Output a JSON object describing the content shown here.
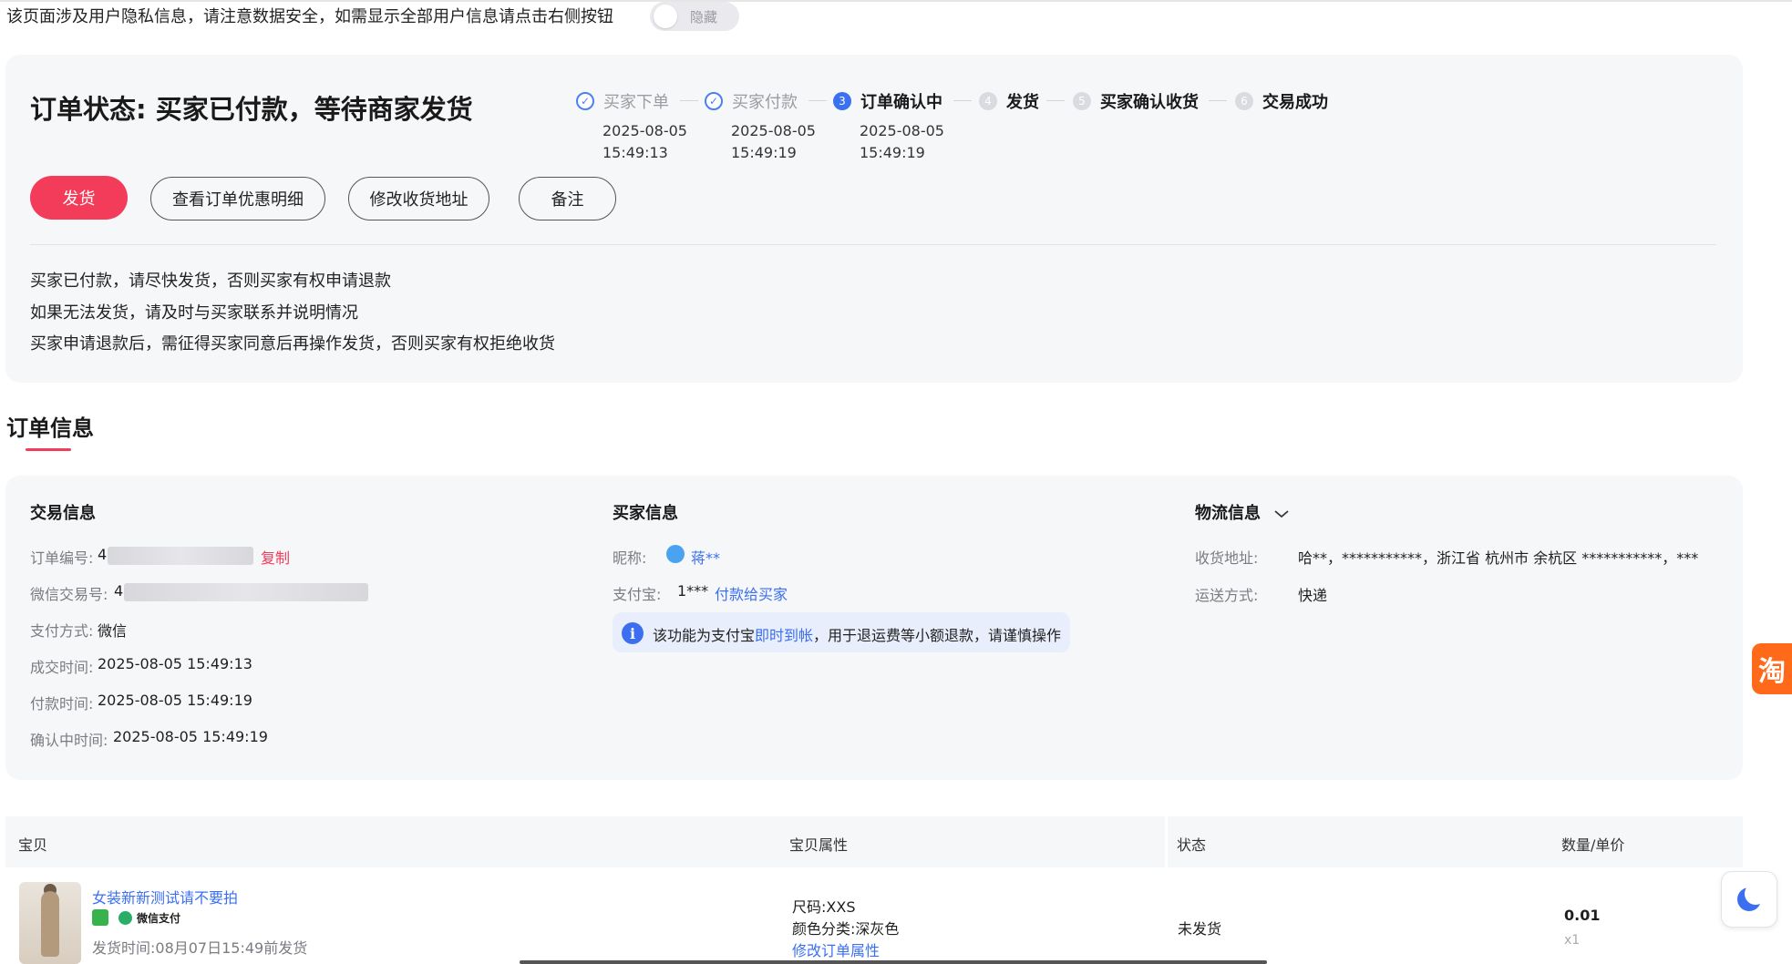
{
  "privacy": {
    "notice": "该页面涉及用户隐私信息，请注意数据安全，如需显示全部用户信息请点击右侧按钮",
    "toggle_label": "隐藏"
  },
  "status": {
    "title": "订单状态: 买家已付款，等待商家发货",
    "steps": [
      {
        "index": "✓",
        "label": "买家下单",
        "date": "2025-08-05",
        "time": "15:49:13",
        "state": "done"
      },
      {
        "index": "✓",
        "label": "买家付款",
        "date": "2025-08-05",
        "time": "15:49:19",
        "state": "done"
      },
      {
        "index": "3",
        "label": "订单确认中",
        "date": "2025-08-05",
        "time": "15:49:19",
        "state": "current"
      },
      {
        "index": "4",
        "label": "发货",
        "state": "todo"
      },
      {
        "index": "5",
        "label": "买家确认收货",
        "state": "todo"
      },
      {
        "index": "6",
        "label": "交易成功",
        "state": "todo"
      }
    ],
    "buttons": {
      "ship": "发货",
      "view_discount": "查看订单优惠明细",
      "edit_address": "修改收货地址",
      "remark": "备注"
    },
    "tips": [
      "买家已付款，请尽快发货，否则买家有权申请退款",
      "如果无法发货，请及时与买家联系并说明情况",
      "买家申请退款后，需征得买家同意后再操作发货，否则买家有权拒绝收货"
    ]
  },
  "order_info": {
    "section_title": "订单信息",
    "trade": {
      "title": "交易信息",
      "order_no_label": "订单编号:",
      "order_no_prefix": "4",
      "copy_label": "复制",
      "wechat_no_label": "微信交易号:",
      "wechat_no_prefix": "4",
      "pay_method_label": "支付方式:",
      "pay_method": "微信",
      "deal_time_label": "成交时间:",
      "deal_time": "2025-08-05 15:49:13",
      "pay_time_label": "付款时间:",
      "pay_time": "2025-08-05 15:49:19",
      "confirm_time_label": "确认中时间:",
      "confirm_time": "2025-08-05 15:49:19"
    },
    "buyer": {
      "title": "买家信息",
      "nickname_label": "昵称:",
      "nickname": "蒋**",
      "alipay_label": "支付宝:",
      "alipay": "1***",
      "pay_to_buyer": "付款给买家",
      "notice_prefix": "该功能为支付宝",
      "notice_link": "即时到帐",
      "notice_suffix": "，用于退运费等小额退款，请谨慎操作"
    },
    "logistics": {
      "title": "物流信息",
      "address_label": "收货地址:",
      "address": "哈**，***********，浙江省 杭州市 余杭区 ***********，***",
      "ship_method_label": "运送方式:",
      "ship_method": "快递"
    }
  },
  "items_table": {
    "headers": [
      "宝贝",
      "宝贝属性",
      "状态",
      "数量/单价"
    ],
    "rows": [
      {
        "title": "女装新新测试请不要拍",
        "pay_badge": "微信支付",
        "ship_deadline": "发货时间:08月07日15:49前发货",
        "attr_size": "尺码:XXS",
        "attr_color": "颜色分类:深灰色",
        "edit_attr": "修改订单属性",
        "status": "未发货",
        "price": "0.01",
        "qty": "x1"
      }
    ]
  },
  "side": {
    "tao_label": "淘"
  },
  "colors": {
    "primary": "#f23c5a",
    "link": "#3b6ff0",
    "panel_bg": "#f6f7f9"
  }
}
